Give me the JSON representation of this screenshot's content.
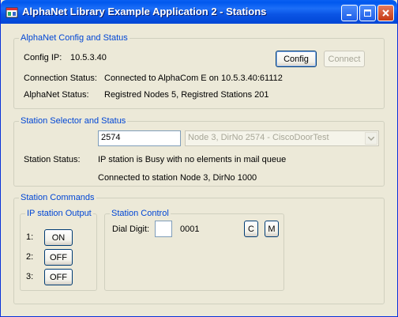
{
  "window": {
    "title": "AlphaNet Library Example Application 2 - Stations"
  },
  "config_group": {
    "legend": "AlphaNet Config and Status",
    "ip_label": "Config IP:",
    "ip_value": "10.5.3.40",
    "config_button": "Config",
    "connect_button": "Connect",
    "conn_status_label": "Connection Status:",
    "conn_status_value": "Connected to AlphaCom E on 10.5.3.40:61112",
    "alphanet_status_label": "AlphaNet Status:",
    "alphanet_status_value": "Registred Nodes 5, Registred Stations 201"
  },
  "selector_group": {
    "legend": "Station Selector and Status",
    "station_input": "2574",
    "station_combo": "Node 3, DirNo 2574 - CiscoDoorTest",
    "status_label": "Station Status:",
    "status_line1": "IP station is Busy with no elements in mail queue",
    "status_line2": "Connected to station Node 3, DirNo 1000"
  },
  "commands_group": {
    "legend": "Station Commands",
    "output_group": {
      "legend": "IP station Output",
      "outputs": [
        {
          "label": "1:",
          "button": "ON"
        },
        {
          "label": "2:",
          "button": "OFF"
        },
        {
          "label": "3:",
          "button": "OFF"
        }
      ]
    },
    "control_group": {
      "legend": "Station Control",
      "dial_label": "Dial Digit:",
      "dial_value": "",
      "dial_display": "0001",
      "c_button": "C",
      "m_button": "M"
    }
  },
  "colors": {
    "titlebar": "#0058ee",
    "legend_text": "#0046d5",
    "window_bg": "#ece9d8"
  }
}
